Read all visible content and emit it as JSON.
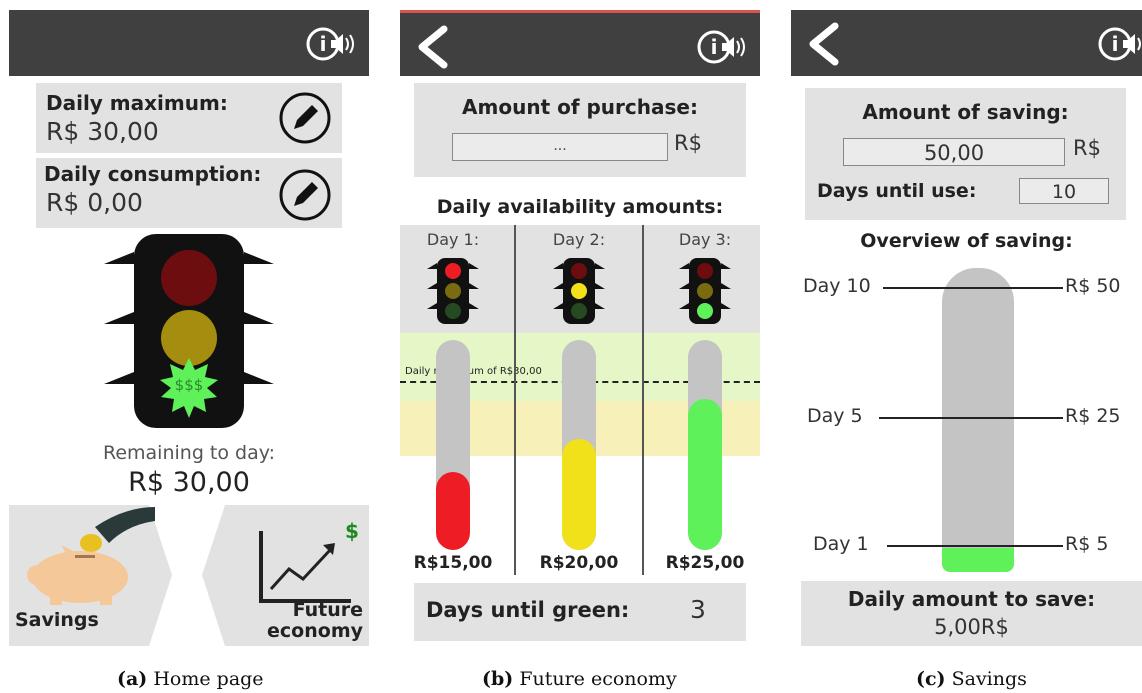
{
  "home": {
    "daily_max_label": "Daily maximum:",
    "daily_max_value": "R$ 30,00",
    "daily_consumption_label": "Daily consumption:",
    "daily_consumption_value": "R$ 0,00",
    "light_sign": "$$$",
    "remaining_label": "Remaining to day:",
    "remaining_value": "R$ 30,00",
    "savings_label": "Savings",
    "future_label_1": "Future",
    "future_label_2": "economy",
    "dollar_sign": "$"
  },
  "future": {
    "purchase_label": "Amount of purchase:",
    "purchase_placeholder": "...",
    "currency": "R$",
    "availability_title": "Daily availability amounts:",
    "max_line_label": "Daily maximum of R$30,00",
    "days": [
      {
        "label": "Day 1:",
        "amount": "R$15,00",
        "lit": "red",
        "fill_fraction": 0.37,
        "fill_color": "#ee1c25"
      },
      {
        "label": "Day 2:",
        "amount": "R$20,00",
        "lit": "yellow",
        "fill_fraction": 0.53,
        "fill_color": "#f1e11a"
      },
      {
        "label": "Day 3:",
        "amount": "R$25,00",
        "lit": "green",
        "fill_fraction": 0.72,
        "fill_color": "#5ef15a"
      }
    ],
    "days_until_green_label": "Days until green:",
    "days_until_green_value": "3"
  },
  "savings": {
    "amount_label": "Amount of saving:",
    "amount_value": "50,00",
    "currency": "R$",
    "days_label": "Days until use:",
    "days_value": "10",
    "overview_title": "Overview of saving:",
    "marks": [
      {
        "day": "Day 10",
        "value": "R$ 50"
      },
      {
        "day": "Day 5",
        "value": "R$ 25"
      },
      {
        "day": "Day 1",
        "value": "R$ 5"
      }
    ],
    "fill_fraction": 0.08,
    "daily_amount_label": "Daily amount to save:",
    "daily_amount_value": "5,00R$"
  },
  "captions": [
    {
      "tag": "(a)",
      "text": "Home page"
    },
    {
      "tag": "(b)",
      "text": "Future economy"
    },
    {
      "tag": "(c)",
      "text": "Savings"
    }
  ],
  "colors": {
    "topbar": "#404040",
    "panel_gray": "#e2e2e2",
    "light_red_on": "#ee1c25",
    "light_yellow_on": "#f1e11a",
    "light_green_on": "#5ef15a"
  }
}
